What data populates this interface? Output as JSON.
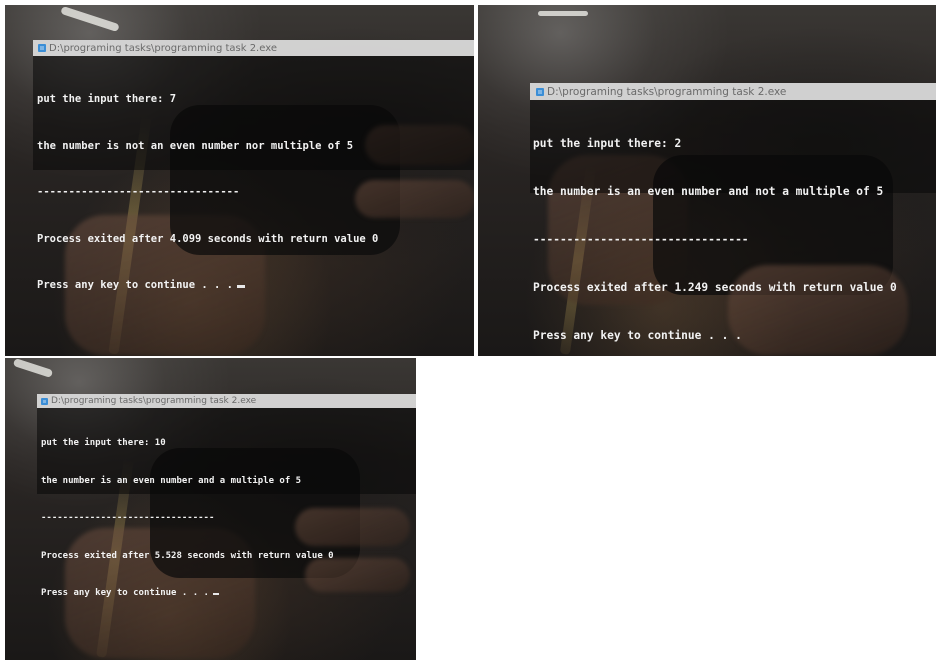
{
  "panels": [
    {
      "title": "D:\\programing tasks\\programming task 2.exe",
      "lines": [
        "put the input there: 7",
        "the number is not an even number nor multiple of 5",
        "--------------------------------",
        "Process exited after 4.099 seconds with return value 0",
        "Press any key to continue . . ."
      ]
    },
    {
      "title": "D:\\programing tasks\\programming task 2.exe",
      "lines": [
        "put the input there: 2",
        "the number is an even number and not a multiple of 5",
        "--------------------------------",
        "Process exited after 1.249 seconds with return value 0",
        "Press any key to continue . . ."
      ]
    },
    {
      "title": "D:\\programing tasks\\programming task 2.exe",
      "lines": [
        "put the input there: 10",
        "the number is an even number and a multiple of 5",
        "--------------------------------",
        "Process exited after 5.528 seconds with return value 0",
        "Press any key to continue . . ."
      ]
    }
  ],
  "colors": {
    "console_text": "#f2f2f2",
    "titlebar_bg": "#e1e1e1",
    "titlebar_text": "#6a6a6a",
    "icon": "#3b8ed6"
  },
  "icons": {
    "app": "console-app-icon"
  }
}
